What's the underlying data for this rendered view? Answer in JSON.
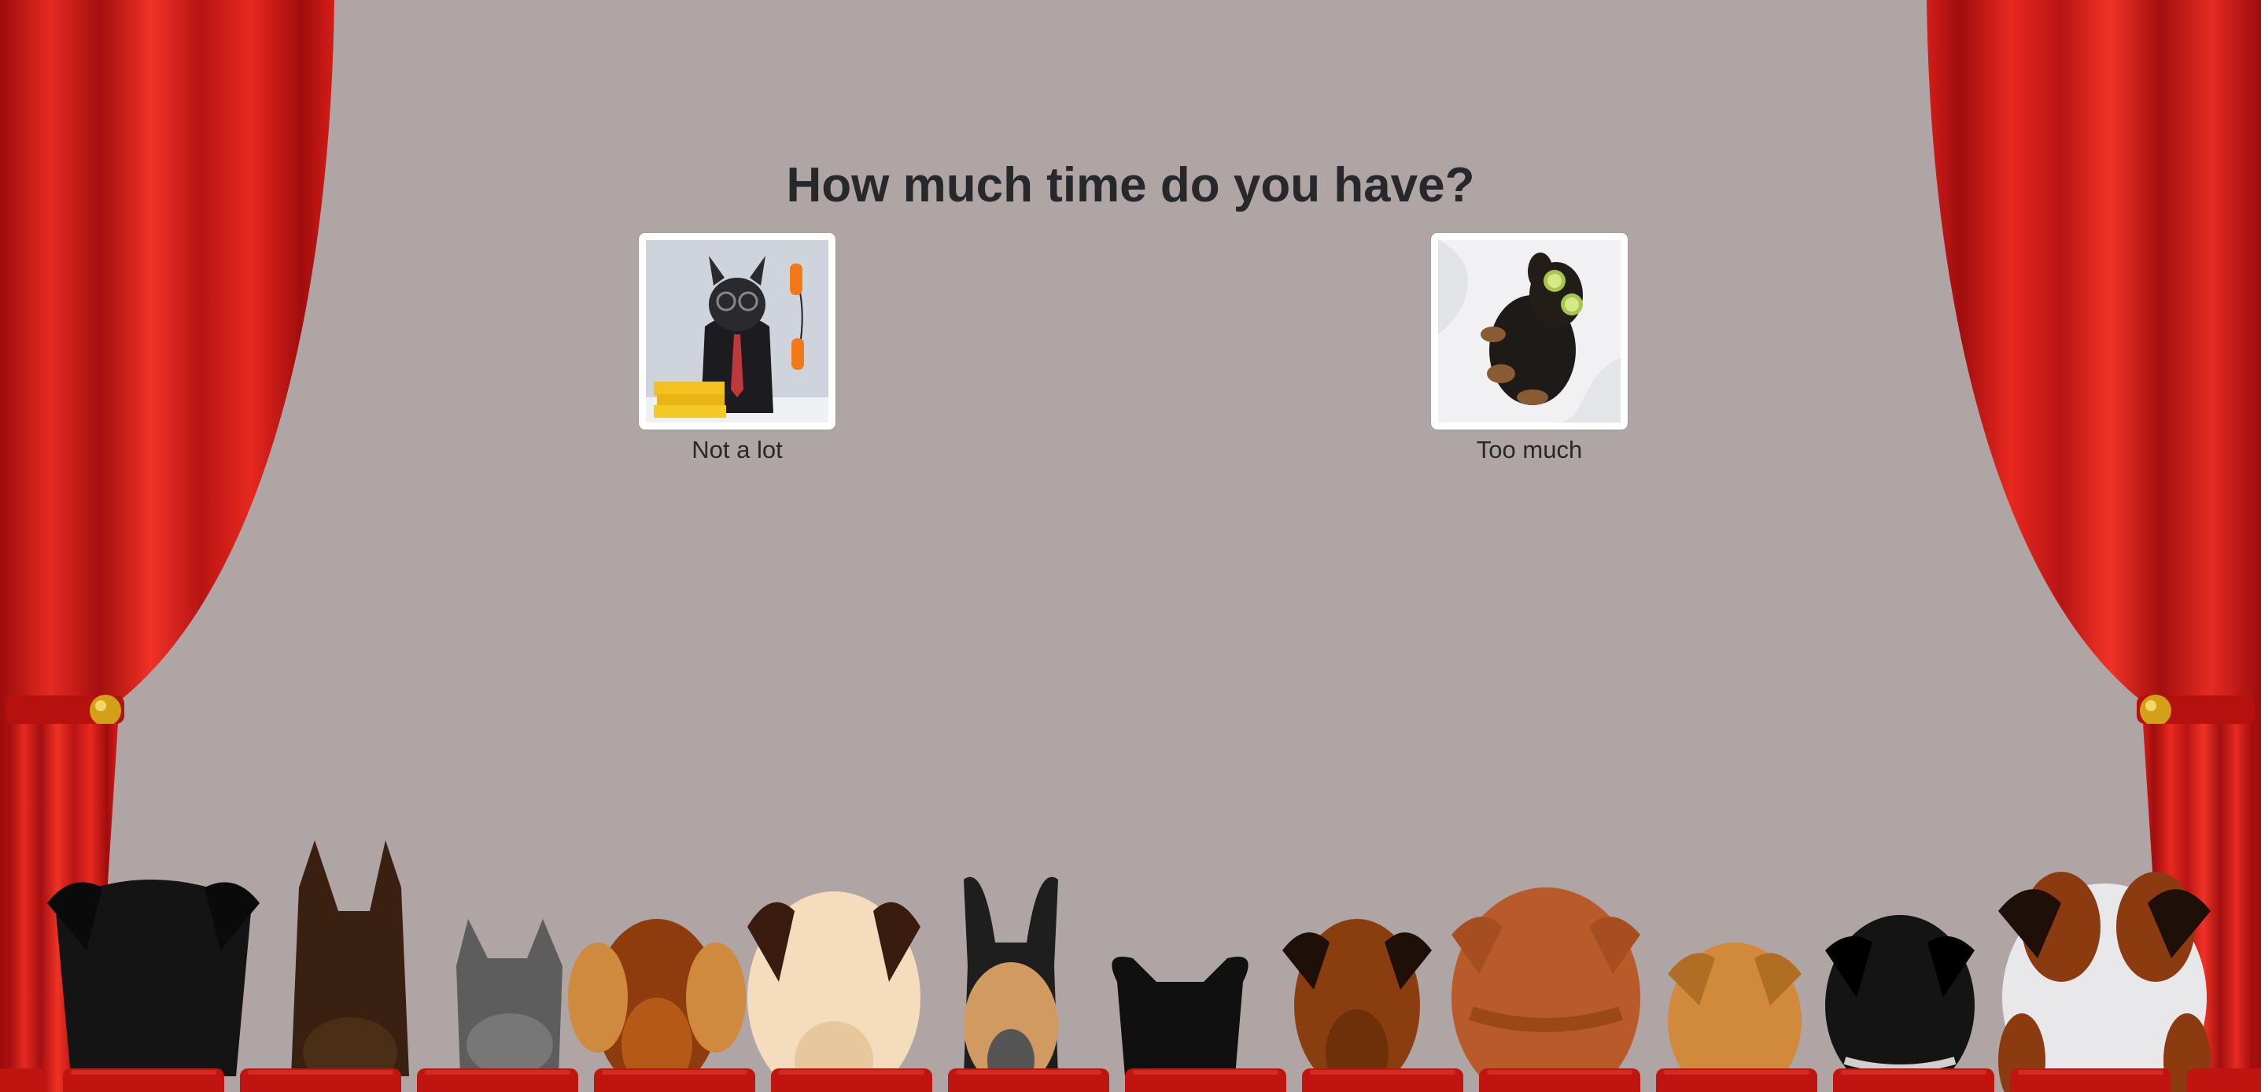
{
  "page": {
    "question": "How much time do you have?"
  },
  "options": [
    {
      "label": "Not a lot",
      "icon": "busy-dog-photo"
    },
    {
      "label": "Too much",
      "icon": "relaxing-dog-photo"
    }
  ],
  "theme": {
    "background": "#b0a5a5",
    "curtain": "#d8201c",
    "seat": "#c01010"
  }
}
